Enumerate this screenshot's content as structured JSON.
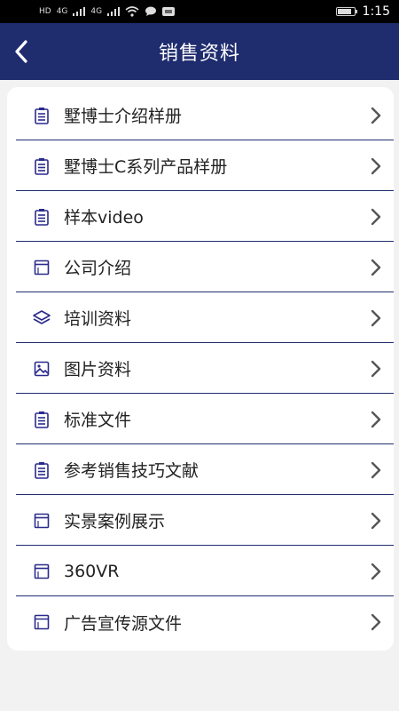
{
  "status_bar": {
    "signal_labels": [
      "HD",
      "4G",
      "4G"
    ],
    "time": "1:15"
  },
  "header": {
    "title": "销售资料"
  },
  "menu": {
    "items": [
      {
        "label": "墅博士介绍样册",
        "icon": "clipboard-list-icon"
      },
      {
        "label": "墅博士C系列产品样册",
        "icon": "clipboard-list-icon"
      },
      {
        "label": "样本video",
        "icon": "clipboard-list-icon"
      },
      {
        "label": "公司介绍",
        "icon": "window-icon"
      },
      {
        "label": "培训资料",
        "icon": "layers-icon"
      },
      {
        "label": "图片资料",
        "icon": "image-icon"
      },
      {
        "label": "标准文件",
        "icon": "clipboard-list-icon"
      },
      {
        "label": "参考销售技巧文献",
        "icon": "clipboard-list-icon"
      },
      {
        "label": "实景案例展示",
        "icon": "window-icon"
      },
      {
        "label": "360VR",
        "icon": "window-icon"
      },
      {
        "label": "广告宣传源文件",
        "icon": "window-icon"
      }
    ]
  },
  "colors": {
    "header_bg": "#1f2d6e",
    "icon": "#2a2a8c",
    "divider": "#1f2d6e",
    "page_bg": "#f2f2f2"
  }
}
